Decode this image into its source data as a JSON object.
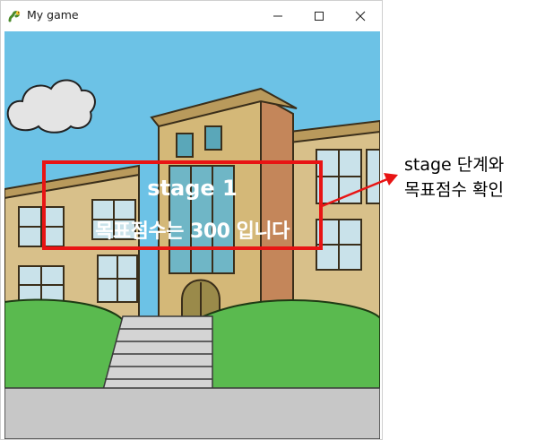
{
  "window": {
    "title": "My game",
    "app_icon": "pygame-snake-icon",
    "controls": [
      "minimize-icon",
      "maximize-icon",
      "close-icon"
    ]
  },
  "game": {
    "stage_label": "stage 1",
    "goal_label": "목표점수는 300 입니다"
  },
  "annotation": {
    "line1": "stage 단계와",
    "line2": "목표점수 확인"
  },
  "colors": {
    "highlight": "#e81414",
    "sky": "#6cc2e6",
    "grass": "#5aba4f",
    "ground": "#c7c7c7"
  }
}
